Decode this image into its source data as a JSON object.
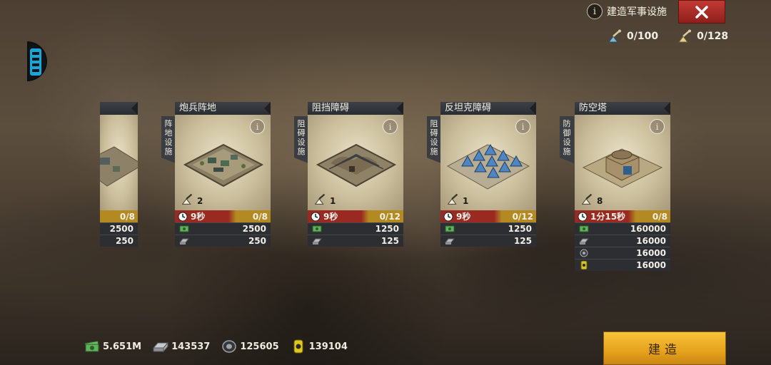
{
  "header": {
    "title": "建造军事设施",
    "close_icon": "close-icon",
    "resources": [
      {
        "icon": "shovel-blue-icon",
        "value": "0/100"
      },
      {
        "icon": "shovel-yellow-icon",
        "value": "0/128"
      }
    ]
  },
  "partial_card": {
    "timer_value": "0/8",
    "costs": [
      "2500",
      "250"
    ]
  },
  "cards": [
    {
      "title": "炮兵阵地",
      "category": "阵地设施",
      "slots": "2",
      "time": "9秒",
      "count": "0/8",
      "costs": [
        {
          "icon": "cash-icon",
          "value": "2500"
        },
        {
          "icon": "steel-icon",
          "value": "250"
        }
      ]
    },
    {
      "title": "阻挡障碍",
      "category": "阻碍设施",
      "slots": "1",
      "time": "9秒",
      "count": "0/12",
      "costs": [
        {
          "icon": "cash-icon",
          "value": "1250"
        },
        {
          "icon": "steel-icon",
          "value": "125"
        }
      ]
    },
    {
      "title": "反坦克障碍",
      "category": "阻碍设施",
      "slots": "1",
      "time": "9秒",
      "count": "0/12",
      "costs": [
        {
          "icon": "cash-icon",
          "value": "1250"
        },
        {
          "icon": "steel-icon",
          "value": "125"
        }
      ]
    },
    {
      "title": "防空塔",
      "category": "防御设施",
      "slots": "8",
      "time": "1分15秒",
      "count": "0/8",
      "costs": [
        {
          "icon": "cash-icon",
          "value": "160000"
        },
        {
          "icon": "steel-icon",
          "value": "16000"
        },
        {
          "icon": "rubber-icon",
          "value": "16000"
        },
        {
          "icon": "oil-icon",
          "value": "16000"
        }
      ]
    }
  ],
  "bottom": {
    "resources": [
      {
        "icon": "cash-icon",
        "value": "5.651M"
      },
      {
        "icon": "steel-icon",
        "value": "143537"
      },
      {
        "icon": "rubber-icon",
        "value": "125605"
      },
      {
        "icon": "oil-icon",
        "value": "139104"
      }
    ],
    "build_label": "建造"
  },
  "colors": {
    "timer_red": "#9a2a21",
    "timer_gold": "#b38a22",
    "build_button": "#e6a21c",
    "close_button": "#c43a34"
  }
}
